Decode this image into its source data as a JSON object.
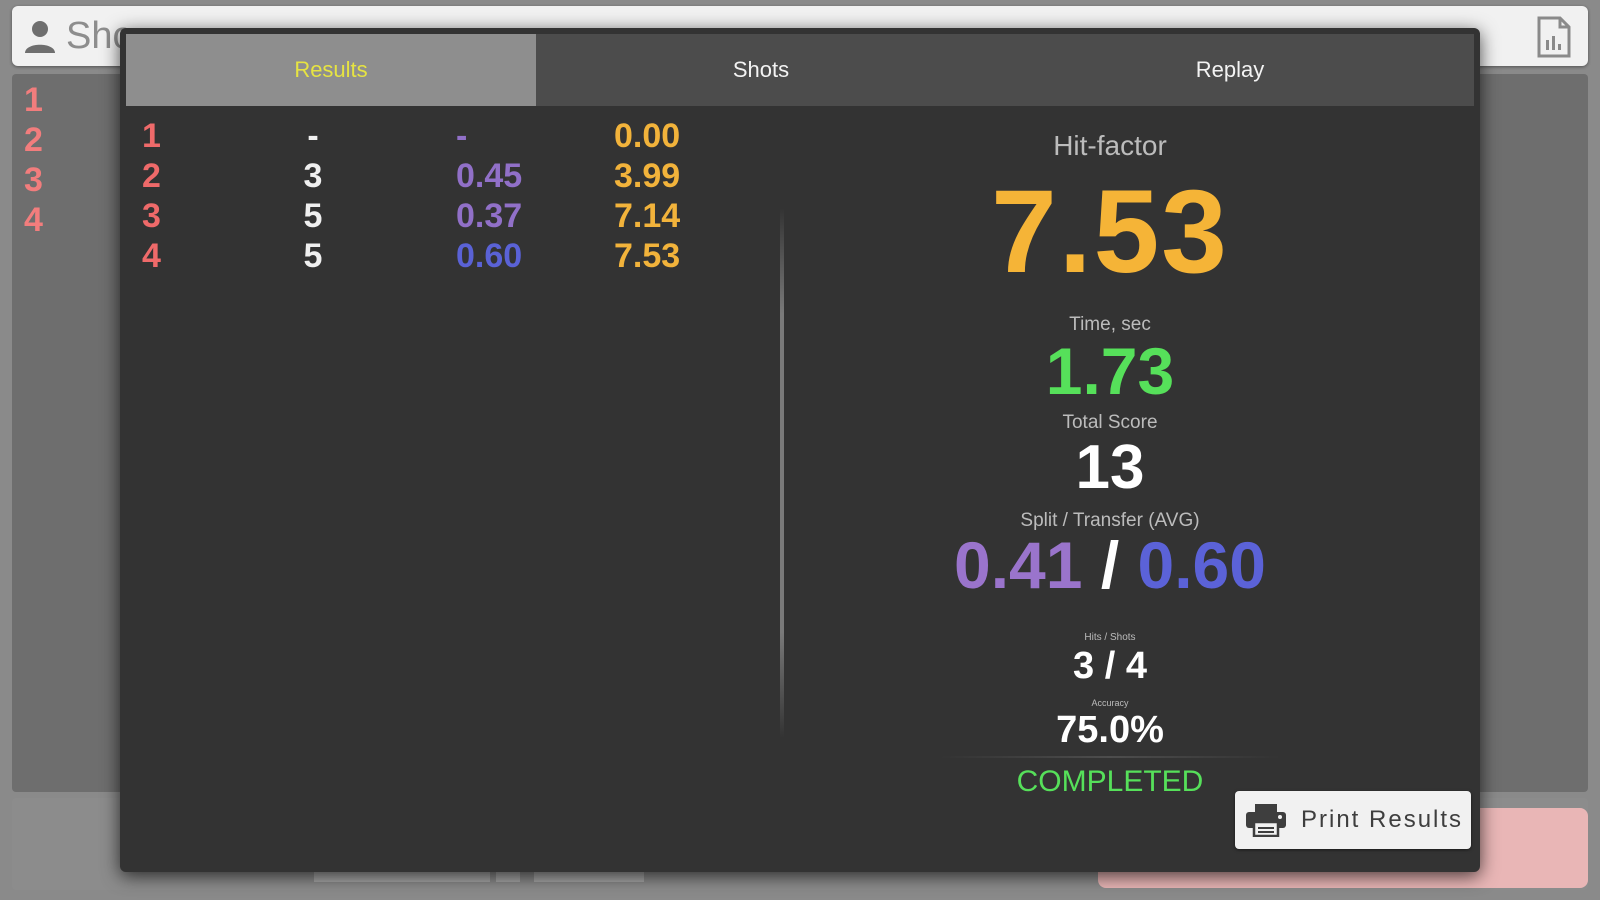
{
  "background": {
    "title": "Sho",
    "shots": [
      "1",
      "2",
      "3",
      "4"
    ]
  },
  "tabs": [
    {
      "label": "Results",
      "active": true
    },
    {
      "label": "Shots",
      "active": false
    },
    {
      "label": "Replay",
      "active": false
    }
  ],
  "results": {
    "rows": [
      {
        "num": "1",
        "score": "-",
        "split": "-",
        "hit_factor": "0.00"
      },
      {
        "num": "2",
        "score": "3",
        "split": "0.45",
        "hit_factor": "3.99"
      },
      {
        "num": "3",
        "score": "5",
        "split": "0.37",
        "hit_factor": "7.14"
      },
      {
        "num": "4",
        "score": "5",
        "split": "0.60",
        "hit_factor": "7.53"
      }
    ]
  },
  "summary": {
    "hit_factor_label": "Hit-factor",
    "hit_factor": "7.53",
    "time_label": "Time, sec",
    "time": "1.73",
    "total_score_label": "Total Score",
    "total_score": "13",
    "split_label": "Split / Transfer (AVG)",
    "split_avg": "0.41",
    "split_separator": "/",
    "transfer_avg": "0.60",
    "hits_label": "Hits / Shots",
    "hits": "3 / 4",
    "accuracy_label": "Accuracy",
    "accuracy": "75.0%",
    "status": "COMPLETED"
  },
  "print_button": {
    "label": "Print Results"
  },
  "colors": {
    "shot_number": "#ef6a6a",
    "split": "#9170c8",
    "transfer": "#5a62d6",
    "hit_factor": "#f2b33b",
    "time": "#56e05a",
    "active_tab": "#e6e342"
  }
}
